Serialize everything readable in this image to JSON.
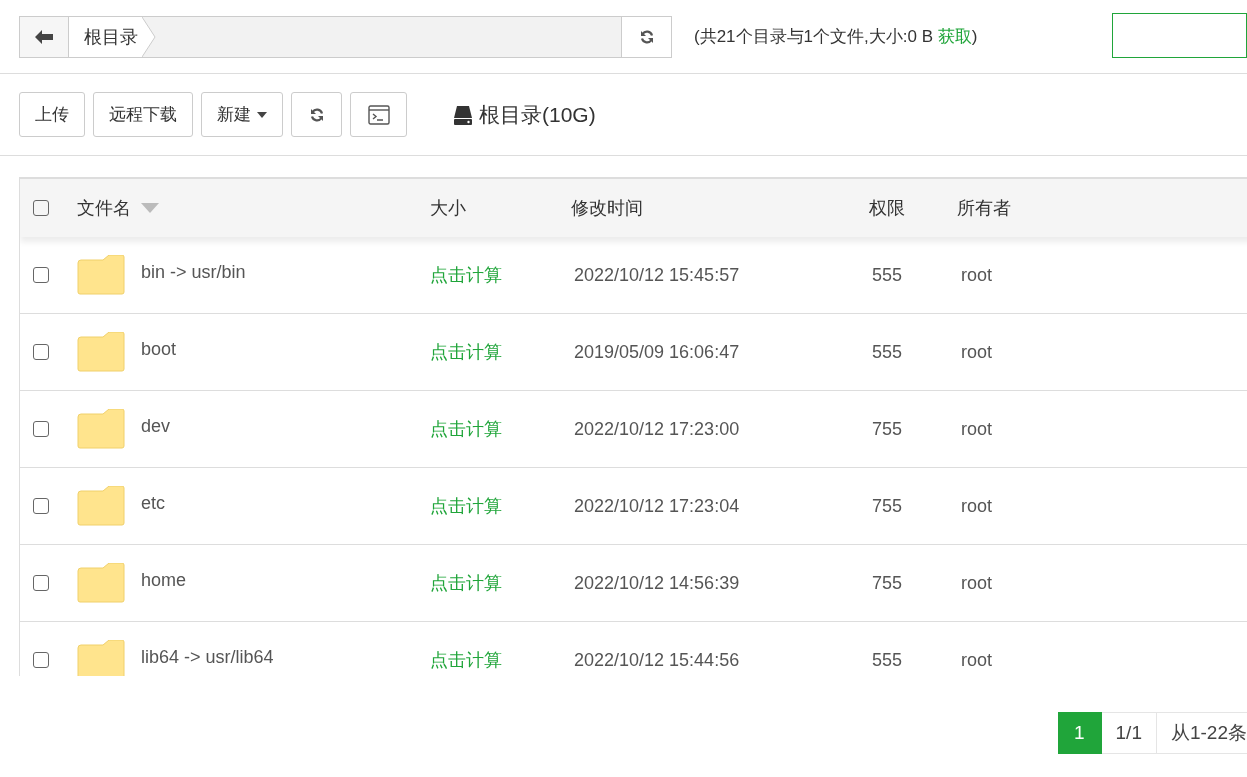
{
  "path_bar": {
    "crumbs": [
      "根目录"
    ]
  },
  "summary": {
    "text": "(共21个目录与1个文件,大小:0 B",
    "link": "获取",
    "close": ")"
  },
  "toolbar": {
    "buttons": [
      {
        "label": "上传",
        "kind": "text"
      },
      {
        "label": "远程下载",
        "kind": "text"
      },
      {
        "label": "新建",
        "kind": "dropdown"
      },
      {
        "kind": "refresh"
      },
      {
        "kind": "terminal"
      }
    ],
    "disk": "根目录(10G)"
  },
  "table": {
    "select_all": {
      "checked": false
    },
    "columns": [
      "文件名",
      "大小",
      "修改时间",
      "权限",
      "所有者"
    ],
    "rows": [
      {
        "checked": false,
        "name": "bin -> usr/bin",
        "size": "点击计算",
        "modified": "2022/10/12 15:45:57",
        "permission": "555",
        "owner": "root"
      },
      {
        "checked": false,
        "name": "boot",
        "size": "点击计算",
        "modified": "2019/05/09 16:06:47",
        "permission": "555",
        "owner": "root"
      },
      {
        "checked": false,
        "name": "dev",
        "size": "点击计算",
        "modified": "2022/10/12 17:23:00",
        "permission": "755",
        "owner": "root"
      },
      {
        "checked": false,
        "name": "etc",
        "size": "点击计算",
        "modified": "2022/10/12 17:23:04",
        "permission": "755",
        "owner": "root"
      },
      {
        "checked": false,
        "name": "home",
        "size": "点击计算",
        "modified": "2022/10/12 14:56:39",
        "permission": "755",
        "owner": "root"
      },
      {
        "checked": false,
        "name": "lib64 -> usr/lib64",
        "size": "点击计算",
        "modified": "2022/10/12 15:44:56",
        "permission": "555",
        "owner": "root"
      }
    ]
  },
  "pagination": {
    "pages": [
      {
        "label": "1",
        "selected": true
      }
    ],
    "page_count": "1/1",
    "range": "从1-22条"
  }
}
